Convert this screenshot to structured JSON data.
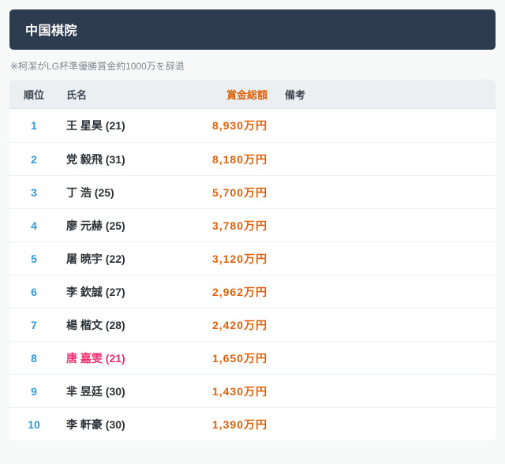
{
  "header": {
    "title": "中国棋院"
  },
  "note": {
    "text": "※柯潔がLG杯準優勝賞金約1000万を辞退"
  },
  "colors": {
    "titlebar_bg": "#2d3c4e",
    "rank_blue": "#3598db",
    "prize_orange": "#dd630e",
    "female_pink": "#ee2e70",
    "header_row_bg": "#ebeff1",
    "page_bg": "#f8f9f9"
  },
  "table": {
    "columns": {
      "rank": "順位",
      "name": "氏名",
      "prize": "賞金総額",
      "remarks": "備考"
    },
    "rows": [
      {
        "rank": "1",
        "name": "王 星昊 (21)",
        "prize": "8,930万円",
        "remarks": ""
      },
      {
        "rank": "2",
        "name": "党 毅飛 (31)",
        "prize": "8,180万円",
        "remarks": ""
      },
      {
        "rank": "3",
        "name": "丁 浩 (25)",
        "prize": "5,700万円",
        "remarks": ""
      },
      {
        "rank": "4",
        "name": "廖 元赫 (25)",
        "prize": "3,780万円",
        "remarks": ""
      },
      {
        "rank": "5",
        "name": "屠 暁宇 (22)",
        "prize": "3,120万円",
        "remarks": ""
      },
      {
        "rank": "6",
        "name": "李 欽誠 (27)",
        "prize": "2,962万円",
        "remarks": ""
      },
      {
        "rank": "7",
        "name": "楊 楷文 (28)",
        "prize": "2,420万円",
        "remarks": ""
      },
      {
        "rank": "8",
        "name": "唐 嘉雯 (21)",
        "prize": "1,650万円",
        "remarks": "",
        "name_color": "#ee2e70"
      },
      {
        "rank": "9",
        "name": "芈 昱廷 (30)",
        "prize": "1,430万円",
        "remarks": ""
      },
      {
        "rank": "10",
        "name": "李 軒豪 (30)",
        "prize": "1,390万円",
        "remarks": ""
      }
    ]
  }
}
